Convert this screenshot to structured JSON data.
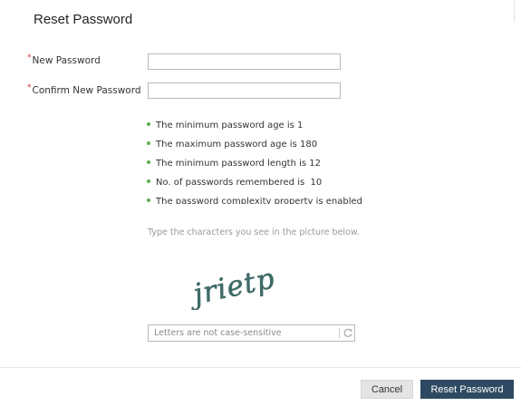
{
  "dialog": {
    "title": "Reset Password"
  },
  "form": {
    "required_marker": "*",
    "new_password": {
      "label": "New Password",
      "value": "",
      "placeholder": ""
    },
    "confirm_password": {
      "label": "Confirm New Password",
      "value": "",
      "placeholder": ""
    }
  },
  "policy_rules": [
    "The minimum password age is 1",
    "The maximum password age is 180",
    "The minimum password length is 12",
    "No. of passwords remembered is  10",
    "The password complexity property is enabled"
  ],
  "captcha": {
    "hint": "Type the characters you see in the picture below.",
    "image_text": "jrietp",
    "input_placeholder": "Letters are not case-sensitive",
    "input_value": "",
    "refresh_icon": "refresh-icon"
  },
  "footer": {
    "cancel_label": "Cancel",
    "reset_label": "Reset Password"
  },
  "colors": {
    "required": "#d9302b",
    "bullet": "#5fae4f",
    "primary_button": "#2e4a62",
    "captcha_text": "#3f6b68"
  }
}
